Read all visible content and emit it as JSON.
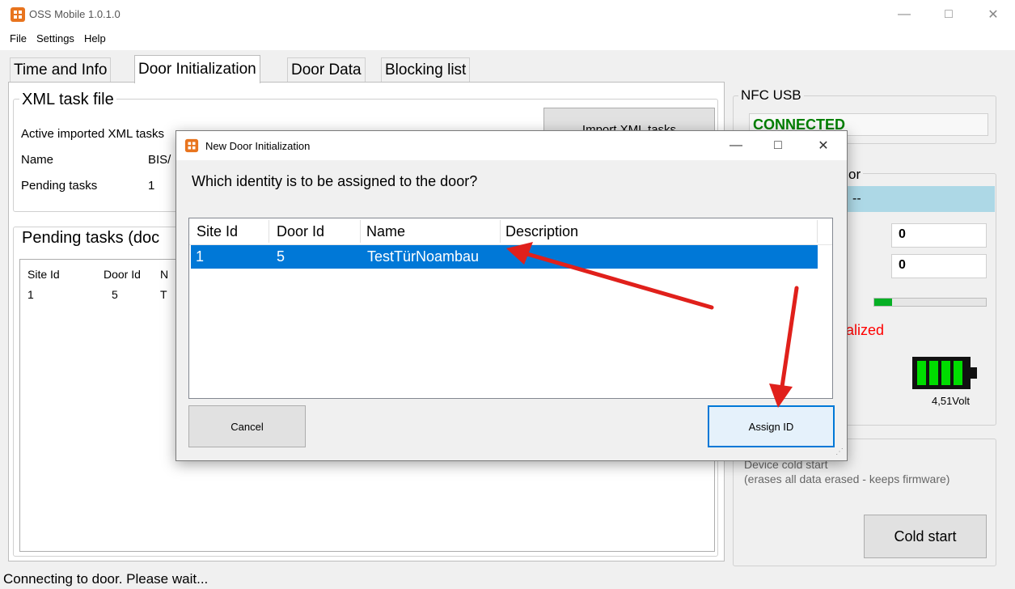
{
  "window": {
    "title": "OSS Mobile 1.0.1.0",
    "min_icon": "minimize-icon",
    "max_icon": "maximize-icon",
    "close_icon": "close-icon"
  },
  "menu": [
    "File",
    "Settings",
    "Help"
  ],
  "tabs": [
    "Time and Info",
    "Door Initialization",
    "Door Data",
    "Blocking list"
  ],
  "active_tab": "Door Initialization",
  "xml_group": {
    "title": "XML task file",
    "active_label": "Active imported XML tasks",
    "name_label": "Name",
    "name_value": "BIS/",
    "pending_label": "Pending tasks",
    "pending_value": "1",
    "import_button": "Import XML tasks"
  },
  "pending_group": {
    "title": "Pending tasks (doc",
    "columns": [
      "Site Id",
      "Door Id",
      "N"
    ],
    "rows": [
      [
        "1",
        "5",
        "T"
      ]
    ]
  },
  "nfc": {
    "title": "NFC USB",
    "status": "CONNECTED"
  },
  "door_group": {
    "title_fragment": "or",
    "value_dash": "--",
    "val1": "0",
    "val2": "0",
    "status_fragment": "alized",
    "battery_voltage": "4,51Volt",
    "progress": 0.16
  },
  "cold": {
    "title": "Device cold start",
    "desc": "(erases all data erased - keeps firmware)",
    "button": "Cold start"
  },
  "status_bar": "Connecting to door. Please wait...",
  "dialog": {
    "title": "New Door Initialization",
    "question": "Which identity is to be assigned to the door?",
    "columns": [
      "Site Id",
      "Door Id",
      "Name",
      "Description"
    ],
    "rows": [
      {
        "site": "1",
        "door": "5",
        "name": "TestTürNoambau",
        "desc": ""
      }
    ],
    "cancel": "Cancel",
    "assign": "Assign ID"
  },
  "colors": {
    "selection": "#0078d7",
    "connected": "#008000",
    "error": "#ff0000",
    "battery": "#00c000",
    "arrow": "#e0201b"
  }
}
